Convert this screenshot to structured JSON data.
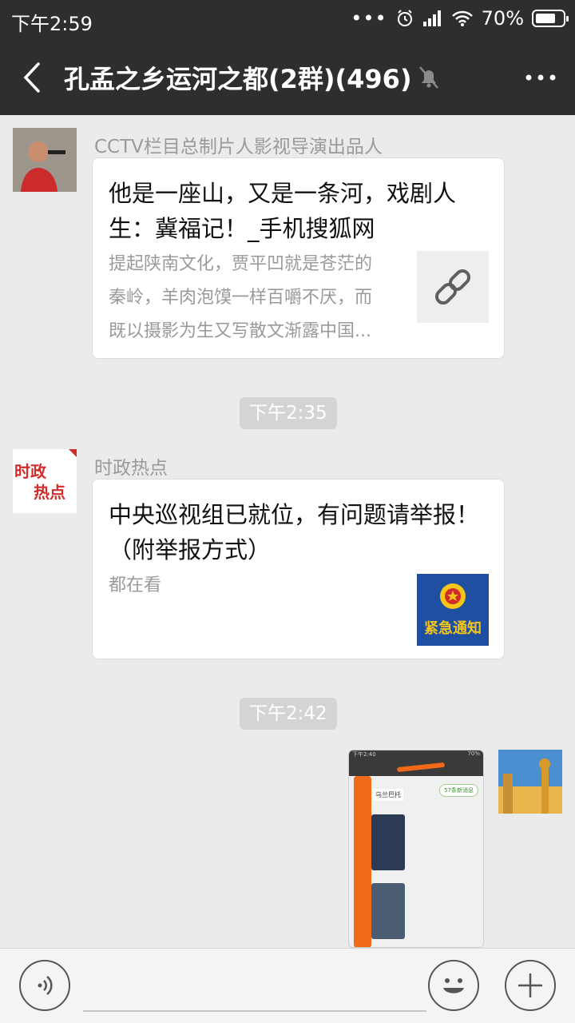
{
  "status": {
    "time": "下午2:59",
    "battery": "70%"
  },
  "header": {
    "title": "孔孟之乡运河之都(2群)(496)"
  },
  "messages": [
    {
      "sender": "CCTV栏目总制片人影视导演出品人",
      "title": "他是一座山，又是一条河，戏剧人生：冀福记！_手机搜狐网",
      "description_lines": [
        "提起陕南文化，贾平凹就是苍茫的",
        "秦岭，羊肉泡馍一样百嚼不厌，而",
        "既以摄影为生又写散文渐露中国..."
      ],
      "thumb_icon": "link-icon"
    },
    {
      "time": "下午2:35"
    },
    {
      "sender": "时政热点",
      "avatar_text": [
        "时政",
        "热点"
      ],
      "title": "中央巡视组已就位，有问题请举报！（附举报方式）",
      "description_lines": [
        "都在看"
      ],
      "thumb_text": "紧急通知"
    },
    {
      "time": "下午2:42"
    },
    {
      "sender": "",
      "image_desc": "screenshot",
      "shot": {
        "time": "下午2:40",
        "battery": "70%",
        "tag": "57条新消息",
        "label": "乌兰巴托"
      }
    }
  ],
  "colors": {
    "bar": "#2e2e2e",
    "chat_bg": "#ebebeb",
    "police_blue": "#1f4fa0",
    "notice_yellow": "#f5c518"
  }
}
